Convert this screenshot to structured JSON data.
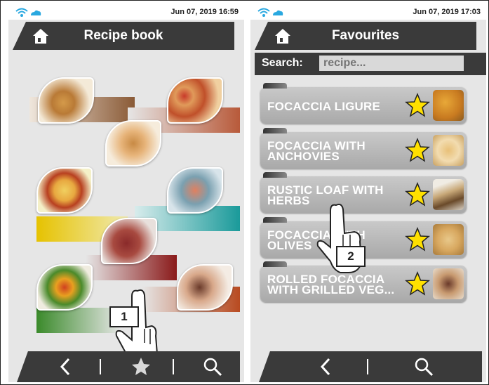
{
  "screens": [
    {
      "time": "Jun 07, 2019  16:59",
      "title": "Recipe book",
      "callout": "1"
    },
    {
      "time": "Jun 07, 2019  17:03",
      "title": "Favourites",
      "search": {
        "label": "Search:",
        "placeholder": "recipe..."
      },
      "items": [
        {
          "label": "FOCACCIA LIGURE"
        },
        {
          "label": "FOCACCIA WITH ANCHOVIES"
        },
        {
          "label": "RUSTIC LOAF WITH HERBS"
        },
        {
          "label": "FOCACCIA WITH OLIVES"
        },
        {
          "label": "ROLLED FOCACCIA WITH GRILLED VEG..."
        }
      ],
      "callout": "2"
    }
  ],
  "icons": [
    "wifi-icon",
    "cloud-icon",
    "home-icon",
    "back-chevron-icon",
    "star-icon",
    "search-icon",
    "hand-pointer-icon"
  ],
  "colors": {
    "header": "#3a3a3a",
    "star": "#ffd700",
    "panel": "#e6e6e6"
  }
}
